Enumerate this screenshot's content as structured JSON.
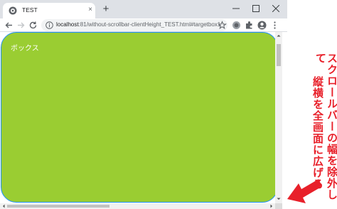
{
  "tab": {
    "title": "TEST",
    "close": "×"
  },
  "toolbar": {
    "new_tab": "+"
  },
  "address": {
    "host": "localhost",
    "rest": ":81/without-scrollbar-clientHeight_TEST.html#targetbox1"
  },
  "page": {
    "box_label": "ボックス"
  },
  "annotation": {
    "line1": "スクロールバーの幅を除外して",
    "line2": "縦横を全画面に広げる"
  },
  "colors": {
    "box_fill": "#9acd32",
    "box_border": "#1e90ff",
    "annotation": "#e8202a"
  },
  "icons": [
    "globe-icon",
    "close-icon",
    "plus-icon",
    "minimize-icon",
    "maximize-icon",
    "window-close-icon",
    "back-arrow-icon",
    "forward-arrow-icon",
    "reload-icon",
    "info-icon",
    "star-icon",
    "extension-icon",
    "puzzle-icon",
    "profile-icon",
    "menu-dots-icon"
  ]
}
